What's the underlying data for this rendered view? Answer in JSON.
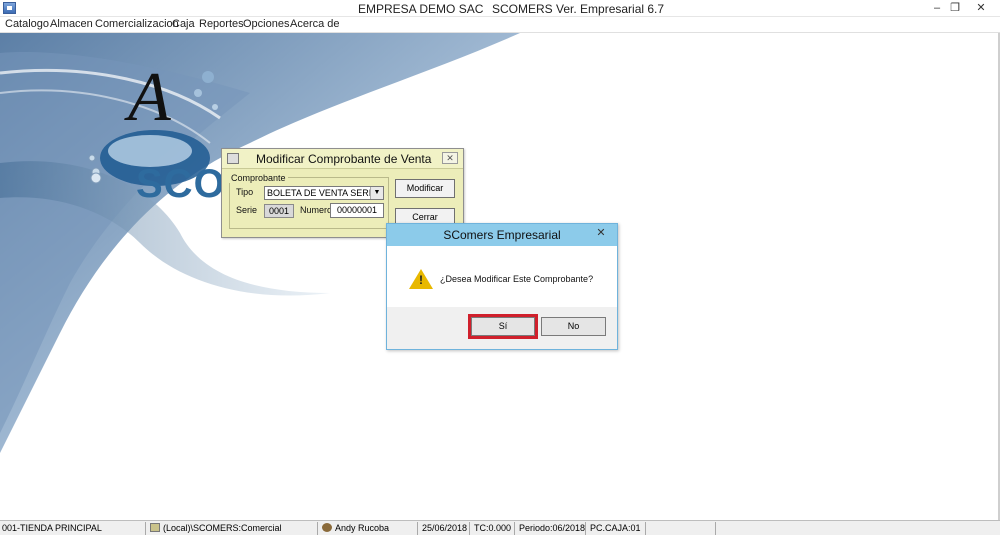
{
  "titlebar": {
    "company": "EMPRESA DEMO SAC",
    "product": "SCOMERS Ver. Empresarial  6.7",
    "minimize_glyph": "–",
    "restore_glyph": "❐",
    "close_glyph": "✕"
  },
  "menu": {
    "items": [
      "Catalogo",
      "Almacen",
      "Comercializacion",
      "Caja",
      "Reportes",
      "Opciones",
      "Acerca de"
    ]
  },
  "background": {
    "brand": "SCOMERS",
    "logo": "A"
  },
  "modify_dialog": {
    "title": "Modificar Comprobante de Venta",
    "close_glyph": "✕",
    "group_label": "Comprobante",
    "tipo_label": "Tipo",
    "tipo_value": "BOLETA DE VENTA SERIE",
    "serie_label": "Serie",
    "serie_value": "0001",
    "numero_label": "Numero",
    "numero_value": "00000001",
    "modify_button": "Modificar",
    "close_button": "Cerrar"
  },
  "message_dialog": {
    "title": "SComers Empresarial",
    "close_glyph": "✕",
    "icon": "warning-icon",
    "message": "¿Desea Modificar Este Comprobante?",
    "yes_button": "Sí",
    "no_button": "No",
    "highlight_color": "#d0202c"
  },
  "statusbar": {
    "store": "001-TIENDA PRINCIPAL",
    "server": "(Local)\\SCOMERS:Comercial",
    "user": "Andy Rucoba",
    "date": "25/06/2018",
    "tc": "TC:0.000",
    "period": "Periodo:06/2018",
    "cashbox": "PC.CAJA:01"
  }
}
